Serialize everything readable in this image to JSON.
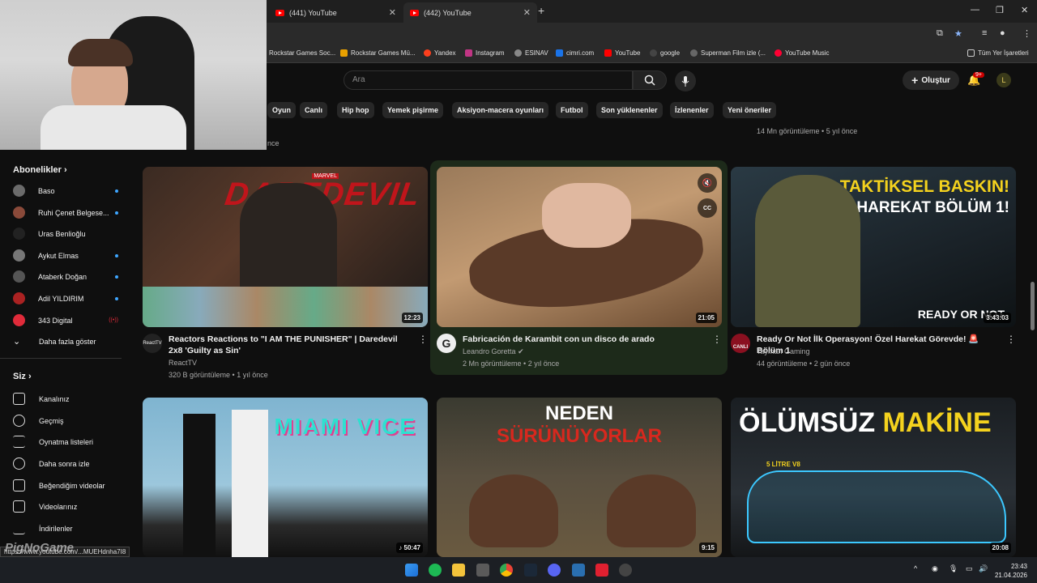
{
  "browser": {
    "tabs": [
      {
        "label": "(441) YouTube",
        "active": false
      },
      {
        "label": "(442) YouTube",
        "active": true
      }
    ],
    "bookmarks": [
      "Rockstar Games Soc...",
      "Rockstar Games Mü...",
      "Yandex",
      "Instagram",
      "ESINAV",
      "cimri.com",
      "YouTube",
      "google",
      "Superman Film izle (...",
      "YouTube Music"
    ],
    "all_bookmarks": "Tüm Yer İşaretleri"
  },
  "header": {
    "search_placeholder": "Ara",
    "create_label": "Oluştur",
    "notif_count": "9+",
    "avatar_letter": "L"
  },
  "chips": [
    "Oyun",
    "Canlı",
    "Hip hop",
    "Yemek pişirme",
    "Aksiyon-macera oyunları",
    "Futbol",
    "Son yüklenenler",
    "İzlenenler",
    "Yeni öneriler"
  ],
  "prev_meta": "14 Mn görüntüleme • 5 yıl önce",
  "prev_meta_left": "nce",
  "sidebar": {
    "subs_title": "Abonelikler",
    "subs": [
      {
        "name": "Baso",
        "dot": true,
        "color": "#6b6b6b"
      },
      {
        "name": "Ruhi Çenet Belgese...",
        "dot": true,
        "color": "#8a4a3a"
      },
      {
        "name": "Uras Benlioğlu",
        "dot": false,
        "color": "#222222"
      },
      {
        "name": "Aykut Elmas",
        "dot": true,
        "color": "#777777"
      },
      {
        "name": "Ataberk Doğan",
        "dot": true,
        "color": "#555555"
      },
      {
        "name": "Adil YILDIRIM",
        "dot": true,
        "color": "#aa2222"
      },
      {
        "name": "343 Digital",
        "dot": false,
        "color": "#e02b3a",
        "live": "((•))"
      }
    ],
    "show_more": "Daha fazla göster",
    "you_title": "Siz",
    "you_items": [
      "Kanalınız",
      "Geçmiş",
      "Oynatma listeleri",
      "Daha sonra izle",
      "Beğendiğim videolar",
      "Videolarınız",
      "İndirilenler"
    ]
  },
  "videos": [
    {
      "title": "Reactors Reactions to \"I AM THE PUNISHER\" | Daredevil 2x8 'Guilty as Sin'",
      "channel": "ReactTV",
      "meta": "320 B görüntüleme • 1 yıl önce",
      "duration": "12:23",
      "thumb_text": "DAREDEVIL",
      "thumb_small": "MARVEL"
    },
    {
      "title": "Fabricación de Karambit con un disco de arado",
      "channel": "Leandro Goretta",
      "verified": true,
      "meta": "2 Mn görüntüleme • 2 yıl önce",
      "duration": "21:05"
    },
    {
      "title": "Ready Or Not İlk Operasyon! Özel Harekat Görevde! 🚨 Bölüm 1",
      "channel": "Tayman Gaming",
      "meta": "44 görüntüleme • 2 gün önce",
      "duration": "3:43:03",
      "thumb_line1": "TAKTİKSEL BASKIN!",
      "thumb_line2": "ÖZEL HAREKAT BÖLÜM 1!",
      "thumb_logo": "READY OR NOT",
      "ch_badge": "CANLI"
    },
    {
      "duration": "50:47",
      "thumb_text": "MIAMI VICE"
    },
    {
      "duration": "9:15",
      "thumb_line1": "NEDEN",
      "thumb_line2": "SÜRÜNÜYORLAR"
    },
    {
      "duration": "20:08",
      "thumb_line1": "ÖLÜMSÜZ",
      "thumb_line2": "MAKİNE",
      "thumb_small": "5 LİTRE V8"
    }
  ],
  "status_url": "https://www.youtube.com/...MUEHdnha7I8",
  "watermark": "PigNoGame",
  "clock": {
    "time": "23:43",
    "date": "21.04.2026"
  },
  "colors": {
    "bg": "#0f0f0f",
    "accent": "#ff0000",
    "link": "#3ea6ff"
  }
}
